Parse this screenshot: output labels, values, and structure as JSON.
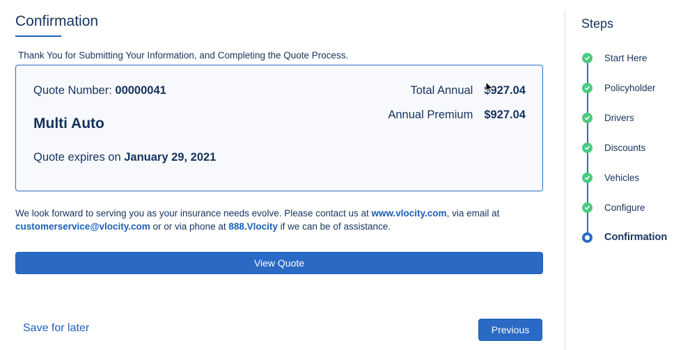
{
  "main": {
    "title": "Confirmation",
    "thanks": "Thank You for Submitting Your Information, and Completing the Quote Process."
  },
  "quote_card": {
    "number_label": "Quote Number: ",
    "number_value": "00000041",
    "product": "Multi Auto",
    "expires_label": "Quote expires on ",
    "expires_value": "January 29, 2021",
    "total_annual_label": "Total Annual",
    "total_annual_value": "$927.04",
    "annual_premium_label": "Annual Premium",
    "annual_premium_value": "$927.04"
  },
  "contact": {
    "text1": "We look forward to serving you as your insurance needs evolve. Please contact us at ",
    "website": "www.vlocity.com",
    "text2": ", via email at ",
    "email": "customerservice@vlocity.com",
    "text3": " or or via phone at ",
    "phone": "888.Vlocity",
    "text4": " if we can be of assistance."
  },
  "buttons": {
    "view_quote": "View Quote",
    "save_for_later": "Save for later",
    "previous": "Previous"
  },
  "steps": {
    "title": "Steps",
    "items": [
      {
        "label": "Start Here",
        "state": "complete"
      },
      {
        "label": "Policyholder",
        "state": "complete"
      },
      {
        "label": "Drivers",
        "state": "complete"
      },
      {
        "label": "Discounts",
        "state": "complete"
      },
      {
        "label": "Vehicles",
        "state": "complete"
      },
      {
        "label": "Configure",
        "state": "complete"
      },
      {
        "label": "Confirmation",
        "state": "current"
      }
    ]
  },
  "colors": {
    "brand_blue": "#2a6ac4",
    "text_navy": "#16325c",
    "success_green": "#4bca81"
  }
}
